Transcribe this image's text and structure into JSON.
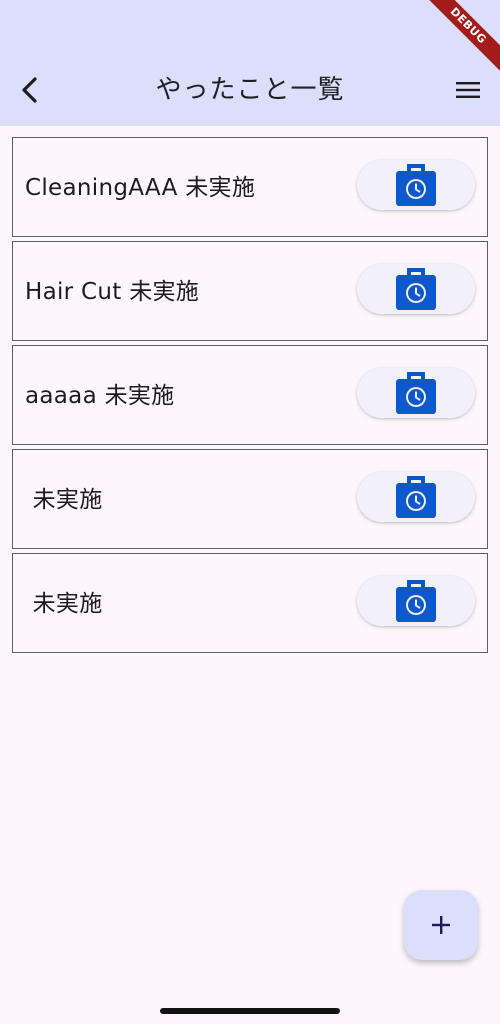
{
  "app_bar": {
    "title": "やったこと一覧",
    "back_icon": "back-arrow-icon",
    "menu_icon": "hamburger-menu-icon",
    "background": "#dcdffc"
  },
  "debug_banner": {
    "label": "DEBUG"
  },
  "items": [
    {
      "label": "CleaningAAA 未実施",
      "button_icon": "work-history-icon"
    },
    {
      "label": "Hair Cut 未実施",
      "button_icon": "work-history-icon"
    },
    {
      "label": "aaaaa 未実施",
      "button_icon": "work-history-icon"
    },
    {
      "label": " 未実施",
      "button_icon": "work-history-icon"
    },
    {
      "label": " 未実施",
      "button_icon": "work-history-icon"
    }
  ],
  "fab": {
    "label": "+",
    "icon": "add-icon"
  },
  "colors": {
    "accent_icon": "#0d57d1",
    "page_background": "#fdf7fb",
    "row_border": "#5e5e66"
  }
}
